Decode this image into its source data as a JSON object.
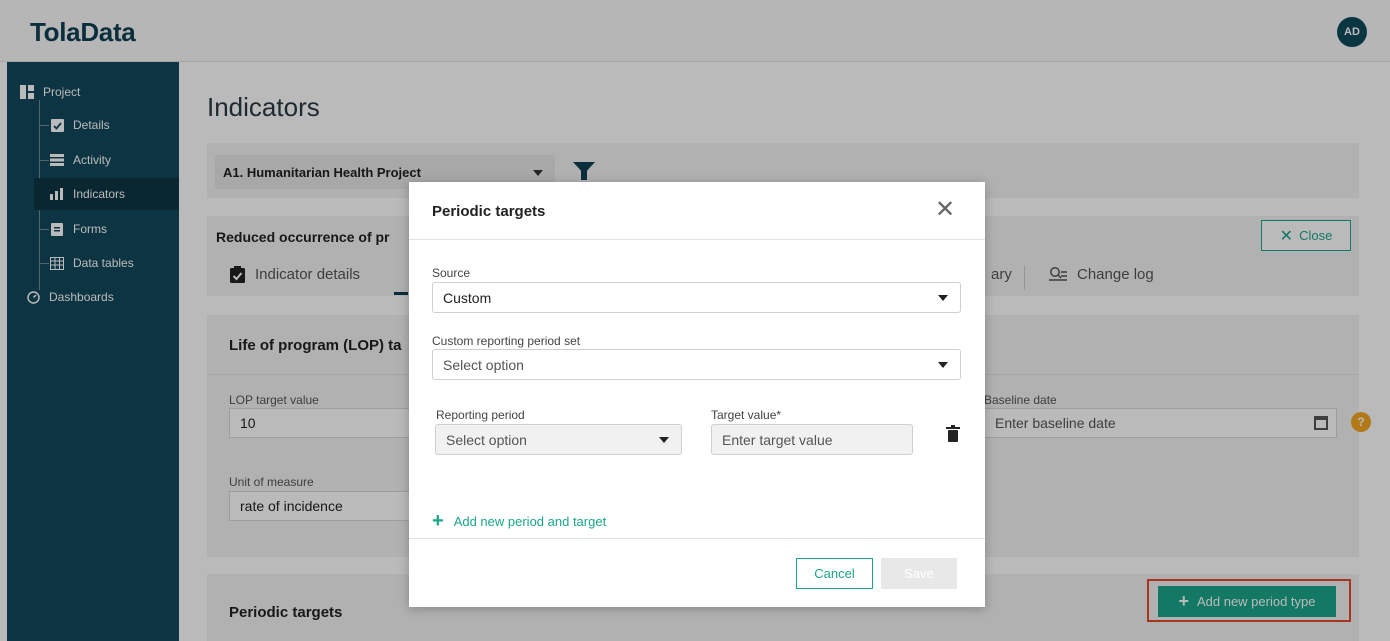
{
  "app": {
    "logo": "TolaData",
    "avatar": "AD"
  },
  "sidebar": {
    "items": [
      {
        "label": "Project",
        "icon": "dashboard-icon"
      },
      {
        "label": "Details",
        "icon": "clipboard-check-icon"
      },
      {
        "label": "Activity",
        "icon": "list-icon"
      },
      {
        "label": "Indicators",
        "icon": "bar-chart-icon",
        "active": true
      },
      {
        "label": "Forms",
        "icon": "clipboard-icon"
      },
      {
        "label": "Data tables",
        "icon": "table-icon"
      },
      {
        "label": "Dashboards",
        "icon": "gauge-icon"
      }
    ]
  },
  "main": {
    "title": "Indicators",
    "project_select": "A1. Humanitarian Health Project",
    "indicator_title": "Reduced occurrence of pr",
    "close_label": "Close",
    "tabs": [
      {
        "label": "Indicator details"
      },
      {
        "label": "ary"
      },
      {
        "label": "Change log"
      }
    ],
    "lop": {
      "title": "Life of program (LOP) ta",
      "target_label": "LOP target value",
      "target_value": "10",
      "unit_label": "Unit of measure",
      "unit_value": "rate of incidence",
      "baseline_label": "Baseline date",
      "baseline_placeholder": "Enter baseline date",
      "help": "?"
    },
    "periodic": {
      "title": "Periodic targets",
      "add_label": "Add new period type"
    }
  },
  "modal": {
    "title": "Periodic targets",
    "source_label": "Source",
    "source_value": "Custom",
    "custom_label": "Custom reporting period set",
    "custom_placeholder": "Select option",
    "period_label": "Reporting period",
    "period_placeholder": "Select option",
    "target_label": "Target value*",
    "target_placeholder": "Enter target value",
    "add_link": "Add new period and target",
    "cancel": "Cancel",
    "save": "Save"
  }
}
